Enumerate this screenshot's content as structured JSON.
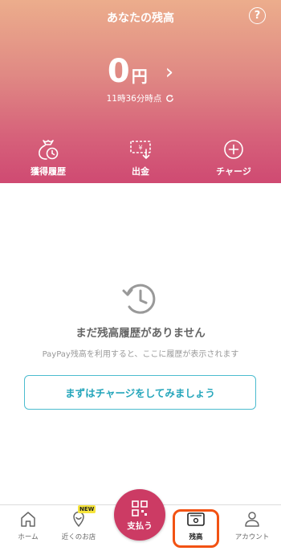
{
  "header": {
    "title": "あなたの残高",
    "help_icon": "?",
    "balance_amount": "0",
    "balance_unit": "円",
    "timestamp": "11時36分時点",
    "actions": [
      {
        "label": "獲得履歴",
        "icon": "money-bag-clock-icon"
      },
      {
        "label": "出金",
        "icon": "withdraw-icon"
      },
      {
        "label": "チャージ",
        "icon": "plus-circle-icon"
      }
    ]
  },
  "empty_state": {
    "icon": "clock-history-icon",
    "title": "まだ残高履歴がありません",
    "subtitle": "PayPay残高を利用すると、ここに履歴が表示されます",
    "button_label": "まずはチャージをしてみましょう"
  },
  "tabbar": {
    "items": [
      {
        "label": "ホーム",
        "icon": "home-icon"
      },
      {
        "label": "近くのお店",
        "icon": "map-pin-icon",
        "badge": "NEW"
      },
      {
        "label": "支払う",
        "icon": "qr-code-icon"
      },
      {
        "label": "残高",
        "icon": "wallet-icon",
        "active": true
      },
      {
        "label": "アカウント",
        "icon": "person-icon"
      }
    ]
  },
  "colors": {
    "accent": "#cc3b64",
    "charge_button": "#4cbccf",
    "active_highlight": "#f25213",
    "new_badge": "#f6e43b"
  }
}
